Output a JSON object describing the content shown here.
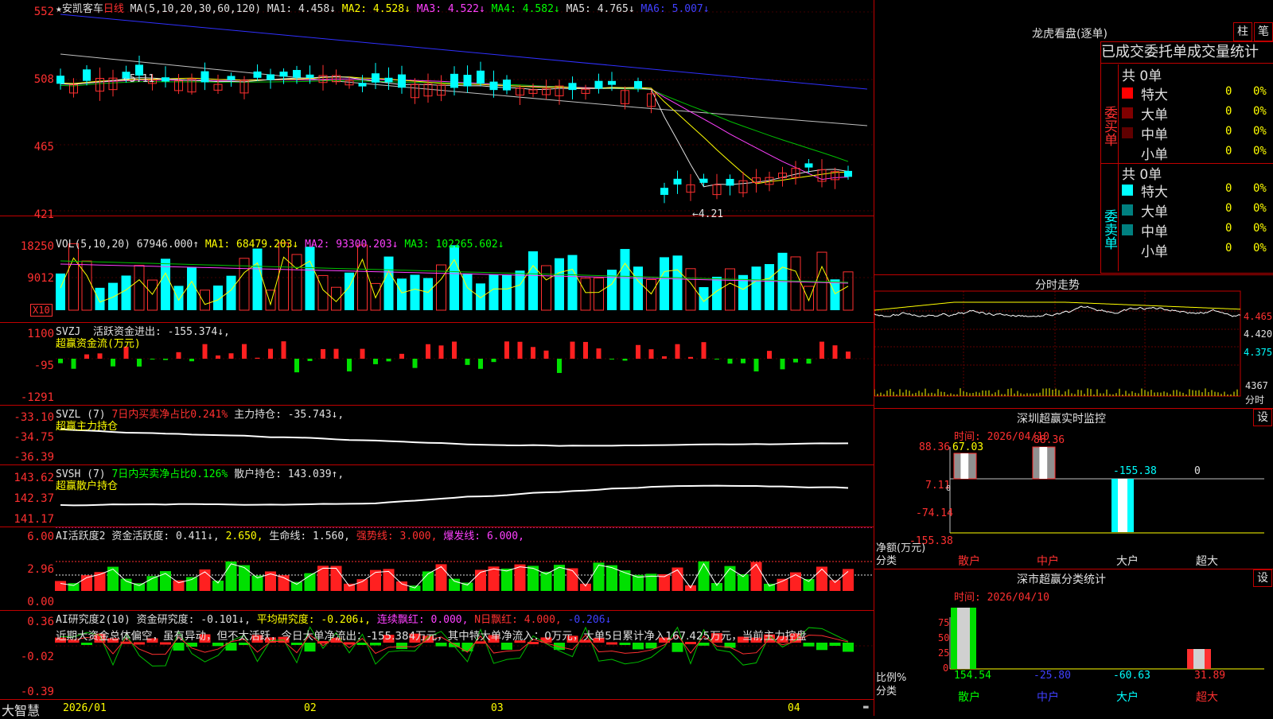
{
  "main_title": {
    "stock": "★安凯客车",
    "period": "日线",
    "ma_def": "MA(5,10,20,30,60,120)",
    "ma1": "MA1: 4.458↓",
    "ma2": "MA2: 4.528↓",
    "ma3": "MA3: 4.522↓",
    "ma4": "MA4: 4.582↓",
    "ma5": "MA5: 4.765↓",
    "ma6": "MA6: 5.007↓"
  },
  "price_axis": [
    "552",
    "508",
    "465",
    "421"
  ],
  "price_marks": {
    "high": "5.11",
    "low": "4.21"
  },
  "vol": {
    "def": "VOL(5,10,20)",
    "value": "67946.000↑",
    "ma1": "MA1: 68479.203↓",
    "ma2": "MA2: 93300.203↓",
    "ma3": "MA3: 102265.602↓",
    "axis": [
      "18250",
      "9012"
    ],
    "unit": "X10"
  },
  "svzj": {
    "def": "SVZJ",
    "line": "活跃资金进出: -155.374↓,",
    "sub": "超赢资金流(万元)",
    "axis": [
      "1100",
      "-95",
      "-1291"
    ]
  },
  "svzl": {
    "def": "SVZL (7)",
    "ratio": "7日内买卖净占比0.241%",
    "hold": "主力持仓: -35.743↓,",
    "sub": "超赢主力持仓",
    "axis": [
      "-33.10",
      "-34.75",
      "-36.39"
    ]
  },
  "svsh": {
    "def": "SVSH (7)",
    "ratio": "7日内买卖净占比0.126%",
    "hold": "散户持仓: 143.039↑,",
    "sub": "超赢散户持仓",
    "axis": [
      "143.62",
      "142.37",
      "141.17"
    ]
  },
  "ai_active": {
    "def": "AI活跃度2",
    "a": "资金活跃度: 0.411↓,",
    "b": "2.650,",
    "c": "生命线: 1.560,",
    "d": "强势线: 3.000,",
    "e": "爆发线: 6.000,",
    "axis": [
      "6.00",
      "2.96",
      "0.00"
    ]
  },
  "ai_research": {
    "def": "AI研究度2(10)",
    "a": "资金研究度: -0.101↓,",
    "b": "平均研究度: -0.206↓,",
    "c": "连续飘红: 0.000,",
    "d": "N日飘红: 4.000,",
    "e": "-0.206↓",
    "text": "近期大资金总体偏空，虽有异动，但不太活跃，今日大单净流出：-155.384万元，其中特大单净流入：0万元，大单5日累计净入167.425万元，当前主力控盘",
    "axis": [
      "0.36",
      "-0.02",
      "-0.39"
    ]
  },
  "bottom": {
    "brand": "大智慧",
    "dates": [
      "2026/01",
      "02",
      "03",
      "04"
    ]
  },
  "lhb": {
    "title": "龙虎看盘(逐单)",
    "btn_col": "柱",
    "btn_pen": "笔",
    "header": "已成交委托单成交量统计",
    "buy_label": "委买单",
    "sell_label": "委卖单",
    "buy_total": "共 0单",
    "sell_total": "共 0单",
    "rows": [
      {
        "name": "特大",
        "n": "0",
        "p": "0%"
      },
      {
        "name": "大单",
        "n": "0",
        "p": "0%"
      },
      {
        "name": "中单",
        "n": "0",
        "p": "0%"
      },
      {
        "name": "小单",
        "n": "0",
        "p": "0%"
      }
    ],
    "buy_colors": [
      "#ff0000",
      "#800000",
      "#600000",
      "#000000"
    ],
    "sell_colors": [
      "#00ffff",
      "#008080",
      "#008080",
      "#000000"
    ]
  },
  "intraday": {
    "title": "分时走势",
    "p1": "4.465",
    "p2": "4.420",
    "p3": "4.375",
    "vol": "4367",
    "unit": "分时"
  },
  "sz_monitor": {
    "title": "深圳超赢实时监控",
    "btn": "设",
    "time": "时间: 2026/04/10",
    "axis": [
      "88.36",
      "7.11",
      "-74.14",
      "-155.38"
    ],
    "zero": "0",
    "ylabel": "净额(万元)",
    "xlabel": "分类",
    "values": {
      "retail": "67.03",
      "mid": "88.36",
      "big": "-155.38",
      "super": "0"
    },
    "cats": [
      "散户",
      "中户",
      "大户",
      "超大"
    ]
  },
  "sz_class": {
    "title": "深市超赢分类统计",
    "btn": "设",
    "time": "时间: 2026/04/10",
    "axis": [
      "75",
      "50",
      "25",
      "0"
    ],
    "ylabel": "比例%",
    "xlabel": "分类",
    "values": [
      "154.54",
      "-25.80",
      "-60.63",
      "31.89"
    ],
    "cats": [
      "散户",
      "中户",
      "大户",
      "超大"
    ]
  }
}
